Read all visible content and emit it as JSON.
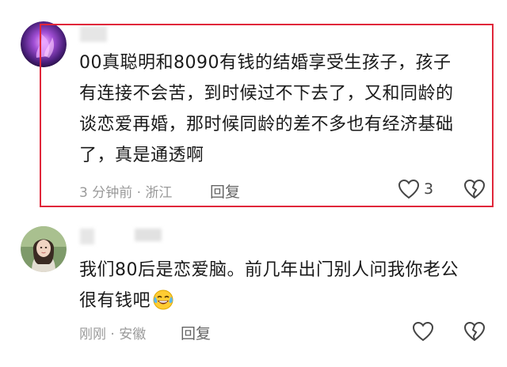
{
  "comments": [
    {
      "text_lines": [
        "00真聪明和8090有钱的结婚享受生孩子，孩子",
        "有连接不会苦，到时候过不下去了，又和同龄的",
        "谈恋爱再婚，那时候同龄的差不多也有经济基础",
        "了，真是通透啊"
      ],
      "meta": "3 分钟前 · 浙江",
      "reply_label": "回复",
      "likes": "3",
      "highlighted": true
    },
    {
      "text_lines": [
        "我们80后是恋爱脑。前几年出门别人问我你老公",
        "很有钱吧"
      ],
      "emoji": "laugh-cry-emoji",
      "meta": "刚刚 · 安徽",
      "reply_label": "回复",
      "highlighted": false
    }
  ],
  "colors": {
    "highlight_border": "#e0263a",
    "meta_text": "#9a9a9a",
    "body_text": "#1a1a1a"
  },
  "icons": [
    "heart-outline-icon",
    "broken-heart-icon",
    "laugh-cry-emoji"
  ]
}
